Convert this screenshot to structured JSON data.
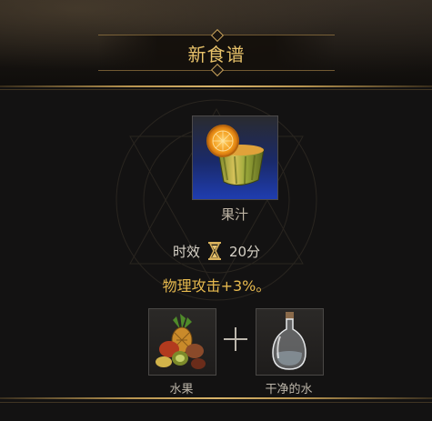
{
  "dialog": {
    "title": "新食谱"
  },
  "recipe": {
    "item_name": "果汁",
    "item_icon": "juice-cup-icon",
    "duration_label": "时效",
    "duration_icon": "hourglass-icon",
    "duration_value": "20分",
    "effect": "物理攻击+3%。"
  },
  "ingredients": [
    {
      "name": "水果",
      "icon": "fruit-basket-icon"
    },
    {
      "name": "干净的水",
      "icon": "water-bottle-icon"
    }
  ],
  "colors": {
    "title_gold": "#e8c26a",
    "effect_gold": "#e6b94e",
    "rarity_blue": "#1f3db0"
  }
}
